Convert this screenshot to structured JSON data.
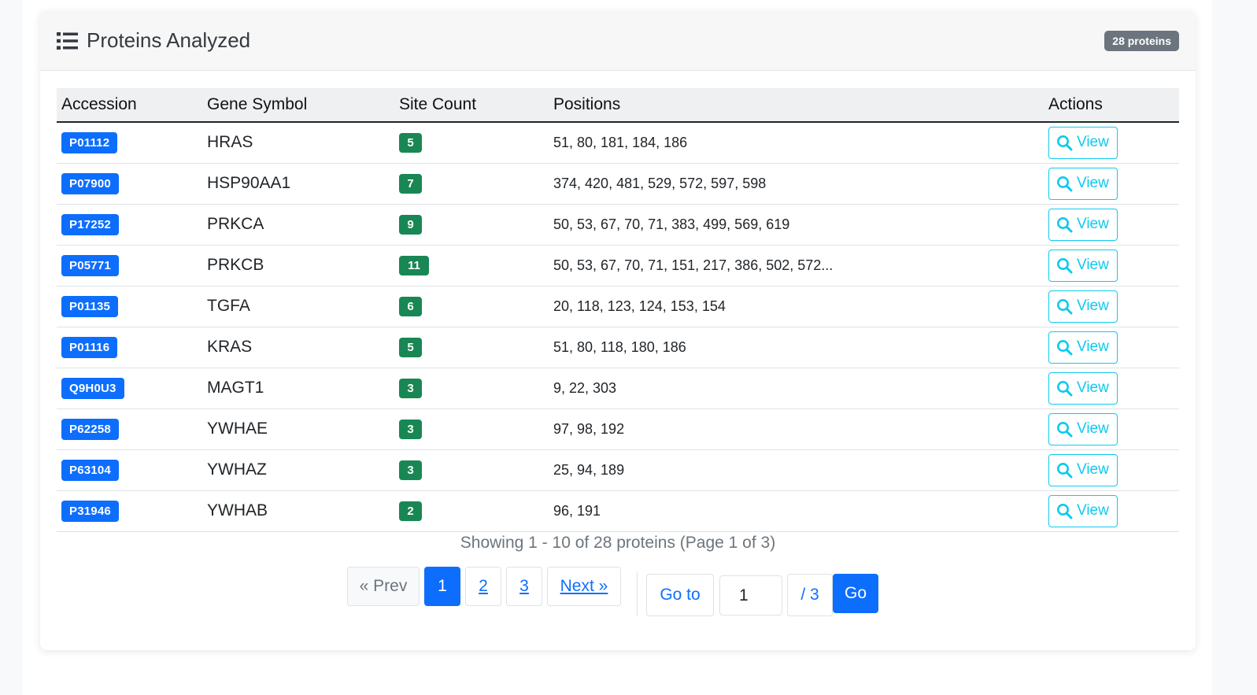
{
  "header": {
    "title": "Proteins Analyzed",
    "count_badge": "28 proteins"
  },
  "table": {
    "columns": [
      "Accession",
      "Gene Symbol",
      "Site Count",
      "Positions",
      "Actions"
    ],
    "action_label": "View",
    "rows": [
      {
        "accession": "P01112",
        "gene": "HRAS",
        "site_count": "5",
        "positions": "51, 80, 181, 184, 186"
      },
      {
        "accession": "P07900",
        "gene": "HSP90AA1",
        "site_count": "7",
        "positions": "374, 420, 481, 529, 572, 597, 598"
      },
      {
        "accession": "P17252",
        "gene": "PRKCA",
        "site_count": "9",
        "positions": "50, 53, 67, 70, 71, 383, 499, 569, 619"
      },
      {
        "accession": "P05771",
        "gene": "PRKCB",
        "site_count": "11",
        "positions": "50, 53, 67, 70, 71, 151, 217, 386, 502, 572..."
      },
      {
        "accession": "P01135",
        "gene": "TGFA",
        "site_count": "6",
        "positions": "20, 118, 123, 124, 153, 154"
      },
      {
        "accession": "P01116",
        "gene": "KRAS",
        "site_count": "5",
        "positions": "51, 80, 118, 180, 186"
      },
      {
        "accession": "Q9H0U3",
        "gene": "MAGT1",
        "site_count": "3",
        "positions": "9, 22, 303"
      },
      {
        "accession": "P62258",
        "gene": "YWHAE",
        "site_count": "3",
        "positions": "97, 98, 192"
      },
      {
        "accession": "P63104",
        "gene": "YWHAZ",
        "site_count": "3",
        "positions": "25, 94, 189"
      },
      {
        "accession": "P31946",
        "gene": "YWHAB",
        "site_count": "2",
        "positions": "96, 191"
      }
    ]
  },
  "pagination": {
    "summary": "Showing 1 - 10 of 28 proteins (Page 1 of 3)",
    "prev_label": "« Prev",
    "pages": [
      "1",
      "2",
      "3"
    ],
    "current_page": "1",
    "next_label": "Next »",
    "goto_label": "Go to",
    "goto_value": "1",
    "goto_total": "/ 3",
    "go_button": "Go"
  },
  "colors": {
    "accession_badge": "#0d6efd",
    "site_badge": "#198754",
    "view_button": "#0dcaf0",
    "count_badge": "#6c757d"
  },
  "icons": {
    "header": "list-icon",
    "view": "search-icon"
  }
}
